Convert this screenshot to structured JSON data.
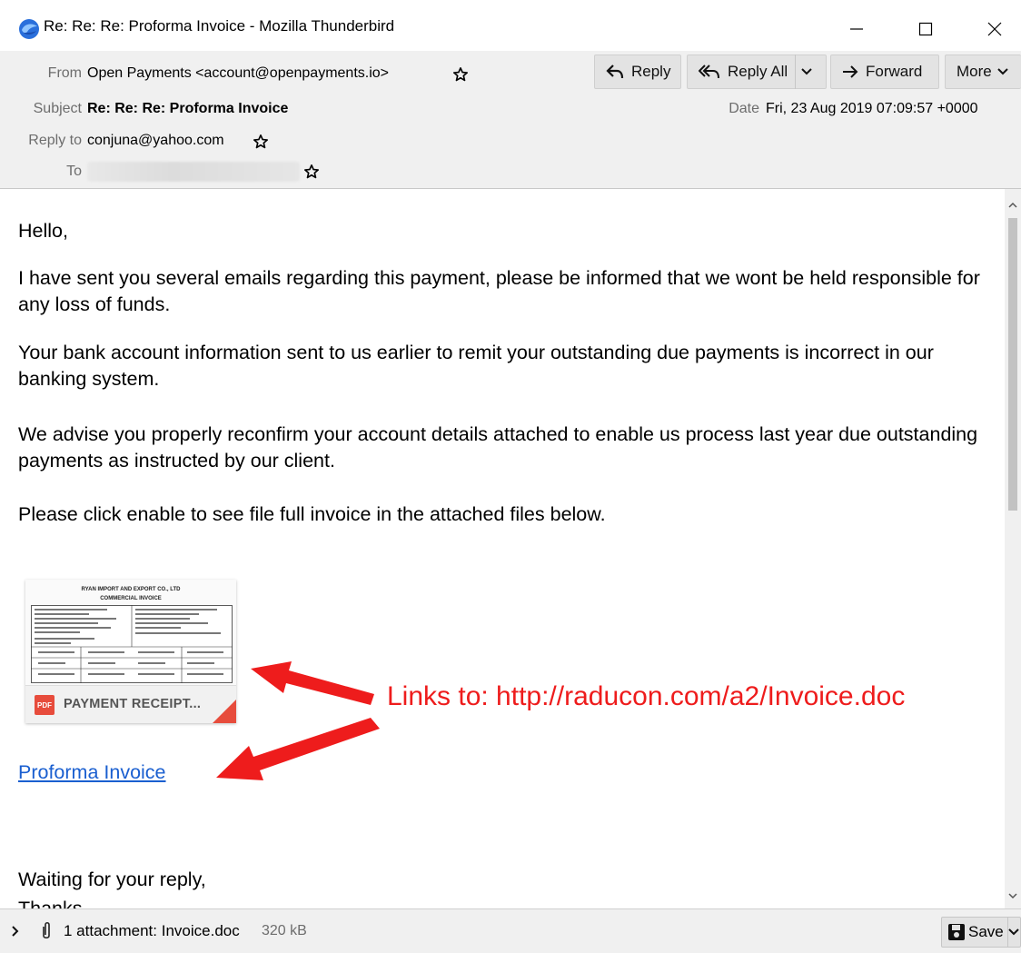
{
  "window": {
    "title": "Re: Re: Re: Proforma Invoice - Mozilla Thunderbird",
    "minimize_label": "",
    "maximize_label": "",
    "close_label": ""
  },
  "header": {
    "from_label": "From",
    "from_value": "Open Payments <account@openpayments.io>",
    "subject_label": "Subject",
    "subject_value": "Re: Re: Re: Proforma Invoice",
    "date_label": "Date",
    "date_value": "Fri, 23 Aug 2019 07:09:57 +0000",
    "reply_to_label": "Reply to",
    "reply_to_value": "conjuna@yahoo.com",
    "to_label": "To"
  },
  "toolbar": {
    "reply_label": "Reply",
    "reply_all_label": "Reply All",
    "forward_label": "Forward",
    "more_label": "More"
  },
  "body": {
    "greeting": "Hello,",
    "paragraph1": "I have sent you several emails regarding this payment, please be informed that we wont be held responsible for any loss of funds.",
    "paragraph2": "Your bank account information sent to us earlier to remit your outstanding due payments is incorrect in our banking system.",
    "paragraph3": "We advise you properly reconfirm your account details attached to enable us process last year due outstanding payments as instructed by our client.",
    "paragraph4": "Please click enable to see file full invoice in the attached files below.",
    "thumbnail_doc_title": "RYAN IMPORT AND EXPORT CO., LTD",
    "thumbnail_doc_subtitle": "COMMERCIAL INVOICE",
    "thumbnail_badge": "PDF",
    "thumbnail_filename": "PAYMENT RECEIPT...",
    "link_text": "Proforma Invoice",
    "closing": "Waiting for your reply,",
    "thanks": "Thanks"
  },
  "annotation": {
    "text": "Links to: http://raducon.com/a2/Invoice.doc",
    "color": "#ee1c1c"
  },
  "attachments": {
    "summary": "1 attachment: Invoice.doc",
    "size": "320 kB",
    "save_label": "Save"
  },
  "colors": {
    "link": "#1a5fd0",
    "header_bg": "#f0f0f0",
    "thunderbird_blue": "#2a6fdb"
  },
  "icons": {
    "app": "thunderbird-logo-icon",
    "star": "star-outline-icon",
    "reply": "reply-arrow-icon",
    "reply_all": "reply-all-arrow-icon",
    "forward": "forward-arrow-icon",
    "paperclip": "paperclip-icon",
    "save": "floppy-disk-icon"
  }
}
